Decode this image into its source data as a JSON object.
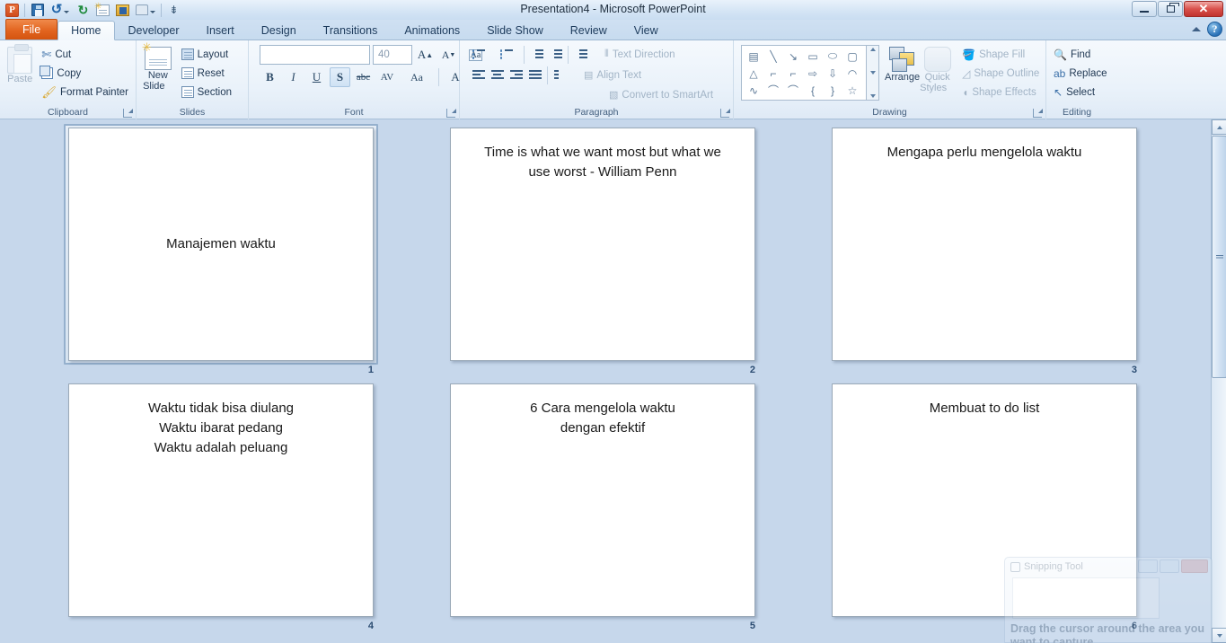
{
  "window": {
    "title": "Presentation4  -  Microsoft PowerPoint",
    "minimize_label": "",
    "restore_label": "",
    "close_label": "✕"
  },
  "quick_access": {
    "items": [
      {
        "name": "powerpoint-orb",
        "label": "P"
      },
      {
        "name": "save-icon",
        "label": ""
      },
      {
        "name": "undo-icon",
        "label": "↺"
      },
      {
        "name": "redo-icon",
        "label": "↻"
      },
      {
        "name": "new-slide-icon",
        "label": ""
      },
      {
        "name": "insert-picture-icon",
        "label": ""
      },
      {
        "name": "print-preview-icon",
        "label": ""
      },
      {
        "name": "customize-qat-icon",
        "label": "⇟"
      }
    ]
  },
  "tabs": [
    {
      "label": "File",
      "active": false,
      "file": true
    },
    {
      "label": "Home",
      "active": true
    },
    {
      "label": "Developer",
      "active": false
    },
    {
      "label": "Insert",
      "active": false
    },
    {
      "label": "Design",
      "active": false
    },
    {
      "label": "Transitions",
      "active": false
    },
    {
      "label": "Animations",
      "active": false
    },
    {
      "label": "Slide Show",
      "active": false
    },
    {
      "label": "Review",
      "active": false
    },
    {
      "label": "View",
      "active": false
    }
  ],
  "help": {
    "label": "?"
  },
  "ribbon": {
    "clipboard": {
      "group_label": "Clipboard",
      "paste_label": "Paste",
      "cut_label": "Cut",
      "copy_label": "Copy",
      "format_painter_label": "Format Painter"
    },
    "slides": {
      "group_label": "Slides",
      "new_slide_label": "New\nSlide",
      "new_slide_line1": "New",
      "new_slide_line2": "Slide",
      "layout_label": "Layout",
      "reset_label": "Reset",
      "section_label": "Section"
    },
    "font": {
      "group_label": "Font",
      "font_name_value": "",
      "font_name_placeholder": "",
      "font_size_value": "40",
      "grow_font_label": "A",
      "shrink_font_label": "A",
      "clear_formatting_label": "Aa",
      "bold_label": "B",
      "italic_label": "I",
      "underline_label": "U",
      "shadow_label": "S",
      "strikethrough_label": "abc",
      "char_spacing_label": "AV",
      "change_case_label": "Aa",
      "font_color_label": "A"
    },
    "paragraph": {
      "group_label": "Paragraph",
      "text_direction_label": "Text Direction",
      "align_text_label": "Align Text",
      "convert_smartart_label": "Convert to SmartArt"
    },
    "drawing": {
      "group_label": "Drawing",
      "arrange_label": "Arrange",
      "quick_styles_line1": "Quick",
      "quick_styles_line2": "Styles",
      "shape_fill_label": "Shape Fill",
      "shape_outline_label": "Shape Outline",
      "shape_effects_label": "Shape Effects",
      "shapes": [
        "A",
        "╲",
        "↘",
        "▭",
        "⬭",
        "▢",
        "△",
        "⌐",
        "⌐",
        "⇨",
        "⇩",
        "◠",
        "∿",
        "⌒",
        "⌒",
        "{",
        "}",
        "☆"
      ]
    },
    "editing": {
      "group_label": "Editing",
      "find_label": "Find",
      "replace_label": "Replace",
      "select_label": "Select"
    }
  },
  "slides": [
    {
      "number": "1",
      "selected": true,
      "vertical_center": true,
      "lines": [
        "Manajemen waktu"
      ]
    },
    {
      "number": "2",
      "selected": false,
      "vertical_center": false,
      "lines": [
        "Time is what we want most but  what we",
        "use worst - William Penn"
      ]
    },
    {
      "number": "3",
      "selected": false,
      "vertical_center": false,
      "lines": [
        "Mengapa perlu mengelola waktu"
      ]
    },
    {
      "number": "4",
      "selected": false,
      "vertical_center": false,
      "lines": [
        "Waktu tidak bisa diulang",
        "Waktu ibarat pedang",
        "Waktu adalah peluang"
      ]
    },
    {
      "number": "5",
      "selected": false,
      "vertical_center": false,
      "lines": [
        "6 Cara mengelola waktu",
        "dengan efektif"
      ]
    },
    {
      "number": "6",
      "selected": false,
      "vertical_center": false,
      "lines": [
        "Membuat to do list"
      ]
    }
  ],
  "snipping_tool": {
    "title": "Snipping Tool",
    "hint_line1": "Drag the cursor around the area you",
    "hint_line2": "want to capture."
  },
  "colors": {
    "accent_orange": "#e2641f",
    "ribbon_bg": "#eaf2fa",
    "sorter_bg": "#c6d7eb",
    "slide_number": "#2b4c72",
    "selection_border": "#95b0cd"
  }
}
